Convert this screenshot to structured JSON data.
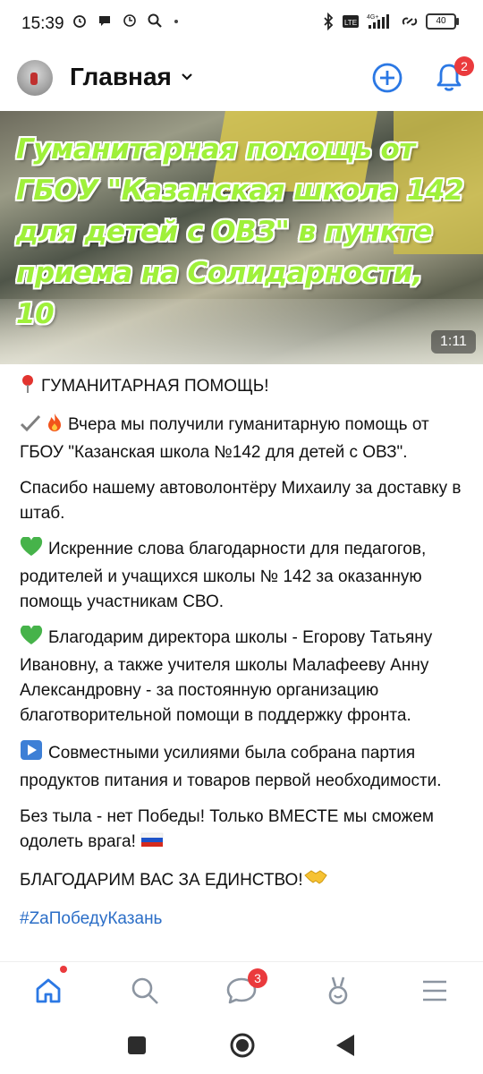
{
  "status_bar": {
    "time": "15:39",
    "battery": "40",
    "network": "4G+"
  },
  "header": {
    "title": "Главная",
    "notifications_count": "2"
  },
  "video": {
    "title": "Гуманитарная помощь от ГБОУ \"Казанская школа 142 для детей с ОВЗ\" в пункте приема на Солидарности, 10",
    "duration": "1:11"
  },
  "post": {
    "p1": "ГУМАНИТАРНАЯ ПОМОЩЬ!",
    "p2": "Вчера мы получили гуманитарную помощь от ГБОУ \"Казанская школа №142 для детей с ОВЗ\".",
    "p3": "Спасибо нашему автоволонтёру Михаилу за доставку в штаб.",
    "p4": "Искренние слова благодарности для педагогов, родителей и учащихся школы № 142 за оказанную помощь участникам СВО.",
    "p5": "Благодарим директора школы - Егорову Татьяну Ивановну, а также учителя школы Малафееву Анну Александровну - за постоянную организацию благотворительной помощи в поддержку фронта.",
    "p6": "Совместными усилиями была собрана партия продуктов питания и товаров первой необходимости.",
    "p7": "Без тыла - нет Победы! Только ВМЕСТЕ мы сможем одолеть врага!",
    "p8": "БЛАГОДАРИМ ВАС ЗА ЕДИНСТВО!",
    "hashtag": "#ZaПобедуКазань"
  },
  "bottom_nav": {
    "messages_count": "3"
  },
  "colors": {
    "accent": "#2b78e4",
    "badge": "#ea3a3d",
    "video_title": "#9ff03a"
  },
  "icons": [
    "alarm-icon",
    "chat-icon",
    "clock-icon",
    "search-icon",
    "bluetooth-icon",
    "signal-icon",
    "add-icon",
    "bell-icon",
    "home-icon",
    "messages-icon",
    "clips-icon",
    "menu-icon"
  ]
}
